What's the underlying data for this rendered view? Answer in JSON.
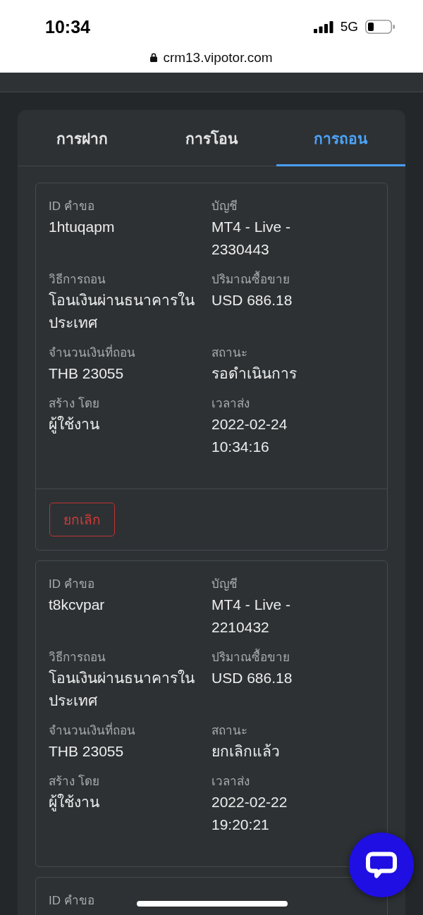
{
  "status_bar": {
    "time": "10:34",
    "network": "5G"
  },
  "address_bar": {
    "url": "crm13.vipotor.com"
  },
  "tabs": [
    {
      "label": "การฝาก",
      "selected": false
    },
    {
      "label": "การโอน",
      "selected": false
    },
    {
      "label": "การถอน",
      "selected": true
    }
  ],
  "requests": [
    {
      "fields": [
        {
          "label": "ID คำขอ",
          "value": "1htuqapm"
        },
        {
          "label": "บัญชี",
          "value": "MT4 - Live - 2330443"
        },
        {
          "label": "วิธีการถอน",
          "value": "โอนเงินผ่านธนาคารในประเทศ"
        },
        {
          "label": "ปริมาณซื้อขาย",
          "value": "USD 686.18"
        },
        {
          "label": "จำนวนเงินที่ถอน",
          "value": "THB 23055"
        },
        {
          "label": "สถานะ",
          "value": "รอดำเนินการ"
        },
        {
          "label": "สร้าง โดย",
          "value": "ผู้ใช้งาน"
        },
        {
          "label": "เวลาส่ง",
          "value": "2022-02-24 10:34:16"
        }
      ],
      "actions": [
        {
          "label": "ยกเลิก",
          "kind": "outline-danger"
        }
      ]
    },
    {
      "fields": [
        {
          "label": "ID คำขอ",
          "value": "t8kcvpar"
        },
        {
          "label": "บัญชี",
          "value": "MT4 - Live - 2210432"
        },
        {
          "label": "วิธีการถอน",
          "value": "โอนเงินผ่านธนาคารในประเทศ"
        },
        {
          "label": "ปริมาณซื้อขาย",
          "value": "USD 686.18"
        },
        {
          "label": "จำนวนเงินที่ถอน",
          "value": "THB 23055"
        },
        {
          "label": "สถานะ",
          "value": "ยกเลิกแล้ว"
        },
        {
          "label": "สร้าง โดย",
          "value": "ผู้ใช้งาน"
        },
        {
          "label": "เวลาส่ง",
          "value": "2022-02-22 19:20:21"
        }
      ]
    },
    {
      "fields": [
        {
          "label": "ID คำขอ"
        }
      ]
    }
  ]
}
